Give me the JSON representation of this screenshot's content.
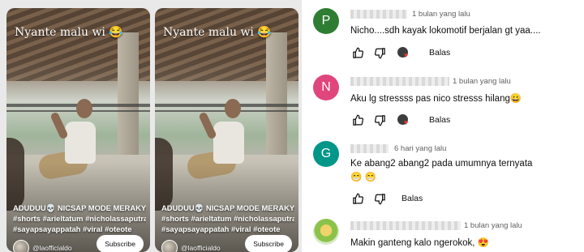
{
  "shorts": [
    {
      "caption": "Nyante malu wi 😂",
      "description_lines": [
        "ADUDUU💀 NICSAP MODE MERAKYAT",
        "#shorts #arieltatum #nicholassaputra",
        "#sayapsayappatah #viral #oteote"
      ],
      "channel": "@laofficialdo",
      "subscribe_label": "Subscribe"
    },
    {
      "caption": "Nyante malu wi 😂",
      "description_lines": [
        "ADUDUU💀 NICSAP MODE MERAKYAT",
        "#shorts #arieltatum #nicholassaputra",
        "#sayapsayappatah #viral #oteote"
      ],
      "channel": "@laofficialdo",
      "subscribe_label": "Subscribe"
    }
  ],
  "comments": [
    {
      "avatar_letter": "P",
      "avatar_color": "#2e7d32",
      "time": "1 bulan yang lalu",
      "text": "Nicho....sdh kayak lokomotif berjalan gt yaa....",
      "reply_label": "Balas",
      "creator_heart": true
    },
    {
      "avatar_letter": "N",
      "avatar_color": "#e0457b",
      "time": "1 bulan yang lalu",
      "text": "Aku lg stressss pas nico stresss hilang😀",
      "reply_label": "Balas",
      "creator_heart": true
    },
    {
      "avatar_letter": "G",
      "avatar_color": "#009688",
      "time": "6 hari yang lalu",
      "text": "Ke abang2 abang2 pada umumnya ternyata",
      "emoji_line": "😁 😁",
      "reply_label": "Balas",
      "creator_heart": false
    },
    {
      "avatar_letter": "",
      "avatar_color": "#8bc34a",
      "time": "1 bulan yang lalu",
      "text": "Makin ganteng kalo ngerokok, 😍",
      "reply_label": "Balas",
      "creator_heart": false
    }
  ]
}
